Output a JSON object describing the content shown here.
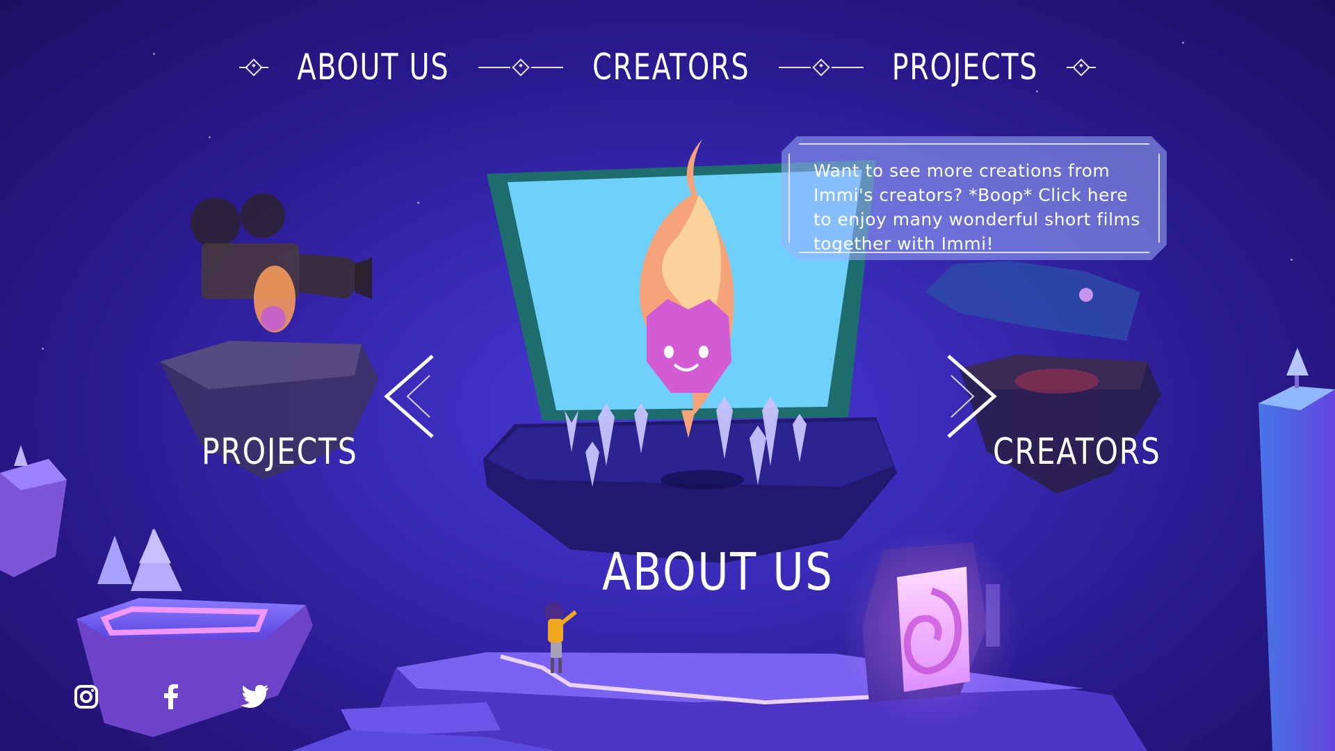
{
  "nav": {
    "about": "ABOUT US",
    "creators": "CREATORS",
    "projects": "PROJECTS"
  },
  "carousel": {
    "left_label": "PROJECTS",
    "right_label": "CREATORS",
    "center_label": "ABOUT US",
    "prev_icon": "chevron-left-icon",
    "next_icon": "chevron-right-icon"
  },
  "tooltip": {
    "text": "Want to see more creations from Immi's creators? *Boop* Click here to enjoy many wonderful short films together with Immi!"
  },
  "social": {
    "instagram_icon": "instagram-icon",
    "facebook_icon": "facebook-icon",
    "twitter_icon": "twitter-icon"
  },
  "colors": {
    "background_deep": "#1c0f63",
    "background_mid": "#3a2bb8",
    "screen_blue": "#6fd0fb",
    "flame_orange": "#f7a37a",
    "flame_face": "#d35bd3",
    "glow_pink": "#e98bff"
  }
}
